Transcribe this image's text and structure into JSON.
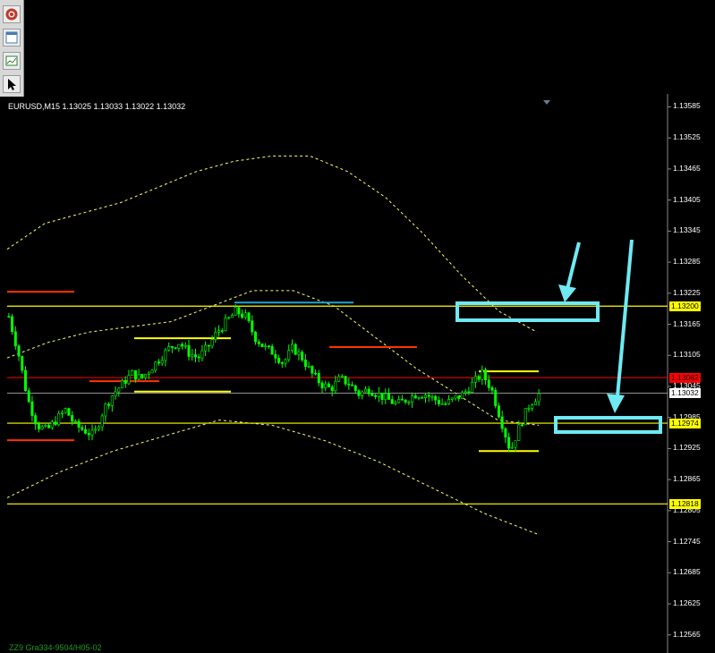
{
  "chart_title": "EURUSD,M15  1.13025 1.13033 1.13022 1.13032",
  "indicator_label": "ZZ9 Gra334-9504/H05-02",
  "toolbar": {
    "icons": [
      "app-logo-icon",
      "window-tile-icon",
      "chart-window-icon",
      "cursor-icon"
    ]
  },
  "colors": {
    "background": "#000000",
    "candles": "#00ff00",
    "level_lines": "#ffff00",
    "bands": "#ffff66",
    "resistance": "#ff3300",
    "highlight": "#6fe9f2",
    "bid_line": "#ff0000",
    "price_line": "#c0c0c0"
  },
  "price_scale": {
    "ticks": [
      "1.13585",
      "1.13525",
      "1.13465",
      "1.13405",
      "1.13345",
      "1.13285",
      "1.13225",
      "1.13165",
      "1.13105",
      "1.13045",
      "1.12985",
      "1.12925",
      "1.12865",
      "1.12805",
      "1.12745",
      "1.12685",
      "1.12625",
      "1.12565"
    ]
  },
  "price_tags": [
    {
      "text": "1.13200",
      "price": 1.132,
      "bg": "#ffff00",
      "fg": "#000000"
    },
    {
      "text": "1.13062",
      "price": 1.13062,
      "bg": "#ff0000",
      "fg": "#000000"
    },
    {
      "text": "1.13032",
      "price": 1.13032,
      "bg": "#ffffff",
      "fg": "#000000"
    },
    {
      "text": "1.12974",
      "price": 1.12974,
      "bg": "#ffff00",
      "fg": "#000000"
    },
    {
      "text": "1.12818",
      "price": 1.12818,
      "bg": "#ffff00",
      "fg": "#000000"
    }
  ],
  "chart_data": {
    "type": "candlestick",
    "symbol": "EURUSD",
    "timeframe": "M15",
    "last_ohlc": {
      "open": 1.13025,
      "high": 1.13033,
      "low": 1.13022,
      "close": 1.13032
    },
    "ylim": [
      1.1253,
      1.1361
    ],
    "horizontal_levels": [
      1.132,
      1.12974,
      1.12818
    ],
    "bid_price": 1.13062,
    "current_price": 1.13032,
    "close_path": [
      1.1318,
      1.1311,
      1.1302,
      1.1297,
      1.1296,
      1.1298,
      1.13,
      1.1297,
      1.1296,
      1.1295,
      1.13,
      1.1303,
      1.1305,
      1.1307,
      1.1306,
      1.1308,
      1.131,
      1.1312,
      1.1313,
      1.1311,
      1.131,
      1.1312,
      1.1315,
      1.1317,
      1.1319,
      1.1318,
      1.1314,
      1.1312,
      1.1311,
      1.1309,
      1.1312,
      1.131,
      1.1307,
      1.1305,
      1.1304,
      1.1306,
      1.1305,
      1.1303,
      1.1304,
      1.1303,
      1.1302,
      1.1301,
      1.1302,
      1.1303,
      1.1303,
      1.1302,
      1.1301,
      1.1302,
      1.1303,
      1.1305,
      1.1307,
      1.1304,
      1.1298,
      1.1292,
      1.1297,
      1.1301,
      1.1303
    ],
    "upper_band": [
      1.1331,
      1.1336,
      1.1338,
      1.134,
      1.1343,
      1.1346,
      1.1348,
      1.1349,
      1.1349,
      1.1346,
      1.1341,
      1.1334,
      1.1326,
      1.1319,
      1.1315
    ],
    "middle_band": [
      1.131,
      1.1313,
      1.1315,
      1.1316,
      1.1317,
      1.132,
      1.1323,
      1.1323,
      1.132,
      1.1314,
      1.1308,
      1.1303,
      1.1298,
      1.1297
    ],
    "lower_band": [
      1.1283,
      1.1288,
      1.1292,
      1.1295,
      1.1298,
      1.1297,
      1.1294,
      1.129,
      1.1285,
      1.128,
      1.1276
    ]
  }
}
